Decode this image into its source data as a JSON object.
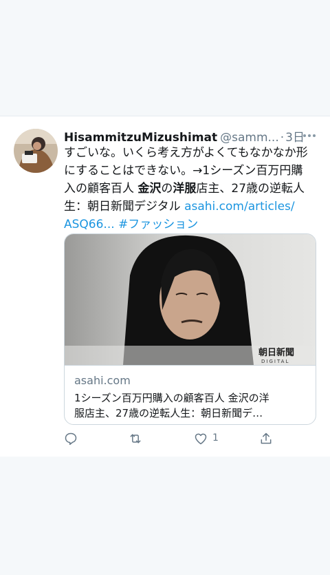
{
  "tweet": {
    "display_name": "HisammitzuMizushimat",
    "handle": "@samm...",
    "separator": "·",
    "time": "3日",
    "text": {
      "line1": "すごいな。いくら考え方がよくてもなかなか形",
      "line2": "にすることはできない。→1シーズン百万円購",
      "line3_a": "入の顧客百人 ",
      "line3_b1": "金沢",
      "line3_c": "の",
      "line3_b2": "洋服",
      "line3_d": "店主、27歳の逆転人",
      "line4_a": "生：朝日新聞デジタル ",
      "line4_link": "asahi.com/articles/",
      "line5_link": "ASQ66...",
      "line5_hashtag": "#ファッション"
    },
    "card": {
      "image_brand": "朝日新聞",
      "image_brand_sub": "DIGITAL",
      "domain": "asahi.com",
      "title_line1": "1シーズン百万円購入の顧客百人 金沢の洋",
      "title_line2": "服店主、27歳の逆転人生：朝日新聞デ…"
    },
    "actions": {
      "like_count": "1"
    }
  },
  "colors": {
    "link": "#1b95e0",
    "secondary_text": "#657786",
    "primary_text": "#14171a",
    "background": "#f5f8fa"
  },
  "icons": {
    "more": "more-dots-icon",
    "reply": "reply-icon",
    "retweet": "retweet-icon",
    "like": "heart-icon",
    "share": "share-icon"
  }
}
